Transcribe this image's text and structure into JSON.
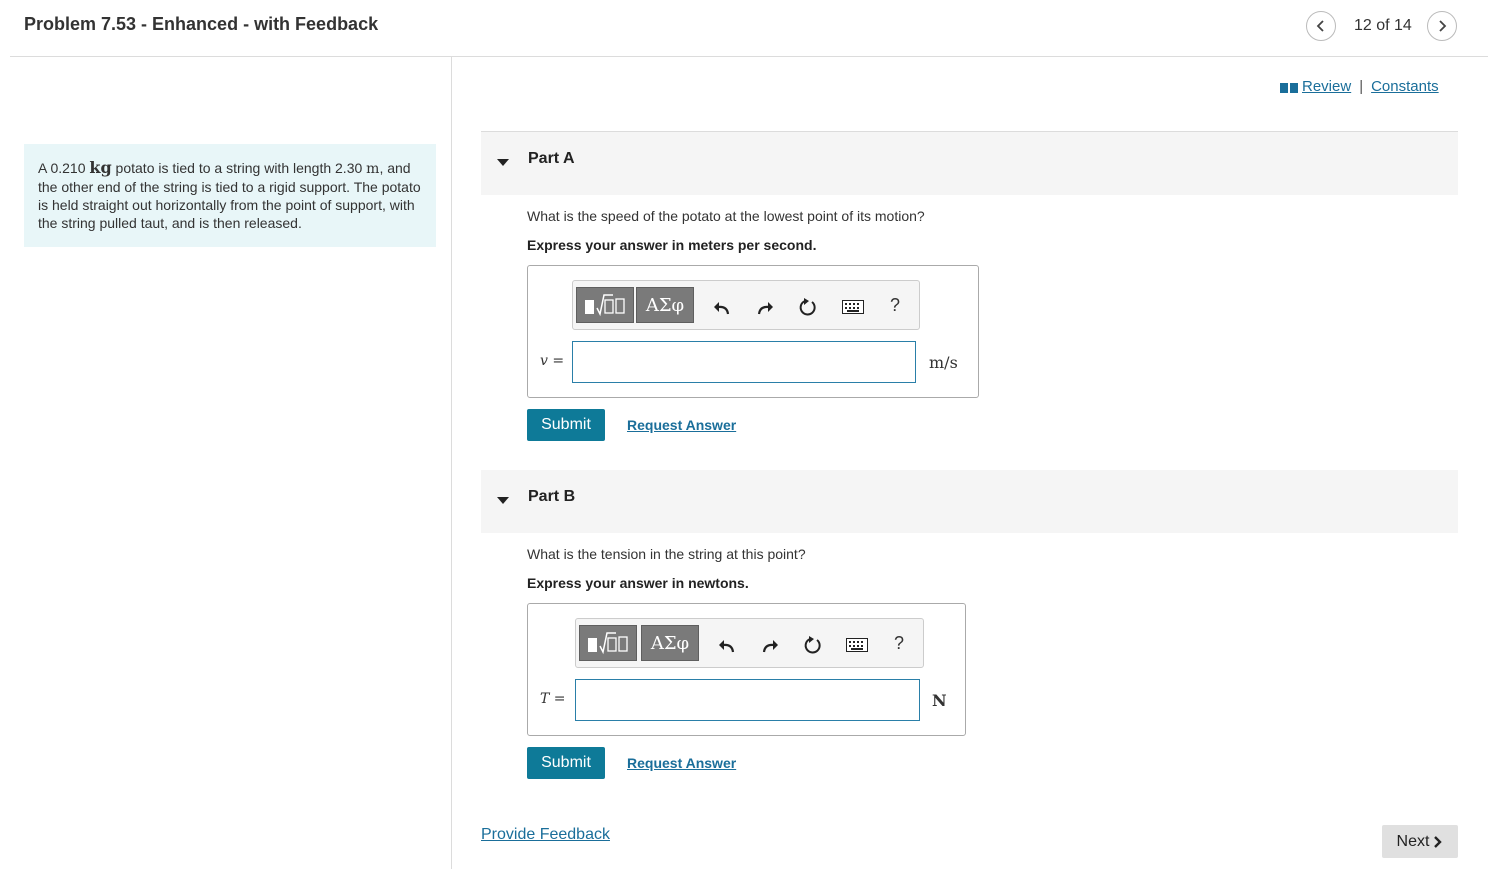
{
  "header": {
    "title": "Problem 7.53 - Enhanced - with Feedback",
    "position": "12 of 14"
  },
  "problem": {
    "text_1": "A 0.210 ",
    "mass_unit": "kg",
    "text_2": " potato is tied to a string with length 2.30 ",
    "length_unit": "m",
    "text_3": ", and the other end of the string is tied to a rigid support. The potato is held straight out horizontally from the point of support, with the string pulled taut, and is then released."
  },
  "links": {
    "review": "Review",
    "constants": "Constants",
    "separator": "|"
  },
  "parts": [
    {
      "title": "Part A",
      "question": "What is the speed of the potato at the lowest point of its motion?",
      "instruction": "Express your answer in meters per second.",
      "variable": "v",
      "equals": " =",
      "unit": "m/s",
      "input_value": "",
      "submit_label": "Submit",
      "request_label": "Request Answer"
    },
    {
      "title": "Part B",
      "question": "What is the tension in the string at this point?",
      "instruction": "Express your answer in newtons.",
      "variable": "T",
      "equals": " =",
      "unit": "N",
      "input_value": "",
      "submit_label": "Submit",
      "request_label": "Request Answer"
    }
  ],
  "toolbar": {
    "greek_label": "ΑΣφ",
    "help_label": "?",
    "icons": [
      "templates-icon",
      "greek-letters-icon",
      "undo-icon",
      "redo-icon",
      "reset-icon",
      "keyboard-icon",
      "help-icon"
    ]
  },
  "footer": {
    "feedback": "Provide Feedback",
    "next": "Next"
  },
  "colors": {
    "accent": "#0e7a98",
    "link": "#1a6e9a",
    "problem_bg": "#e8f6f8",
    "part_header_bg": "#f5f5f5"
  }
}
